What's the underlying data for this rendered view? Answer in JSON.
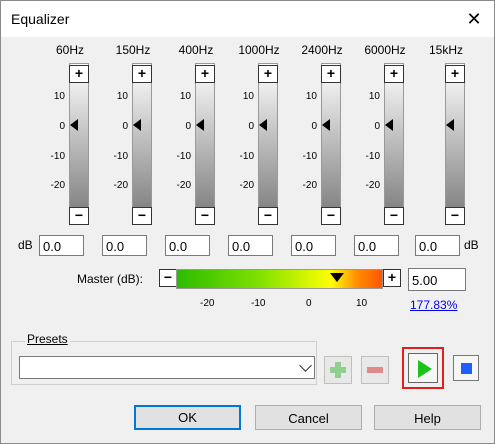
{
  "window": {
    "title": "Equalizer",
    "close_icon": "close-icon"
  },
  "bands": [
    {
      "freq": "60Hz",
      "value": "0.0"
    },
    {
      "freq": "150Hz",
      "value": "0.0"
    },
    {
      "freq": "400Hz",
      "value": "0.0"
    },
    {
      "freq": "1000Hz",
      "value": "0.0"
    },
    {
      "freq": "2400Hz",
      "value": "0.0"
    },
    {
      "freq": "6000Hz",
      "value": "0.0"
    },
    {
      "freq": "15kHz",
      "value": "0.0"
    }
  ],
  "ticks": [
    "10",
    "0",
    "-10",
    "-20"
  ],
  "db_label": "dB",
  "master": {
    "label": "Master (dB):",
    "value": "5.00",
    "percent": "177.83%",
    "ticks": [
      "-20",
      "-10",
      "0",
      "10"
    ]
  },
  "presets": {
    "label": "Presets",
    "selected": ""
  },
  "buttons": {
    "ok": "OK",
    "cancel": "Cancel",
    "help": "Help"
  },
  "colors": {
    "accent": "#0078d7",
    "play": "#19c419",
    "stop": "#1f5fff",
    "highlight": "#e02020"
  }
}
